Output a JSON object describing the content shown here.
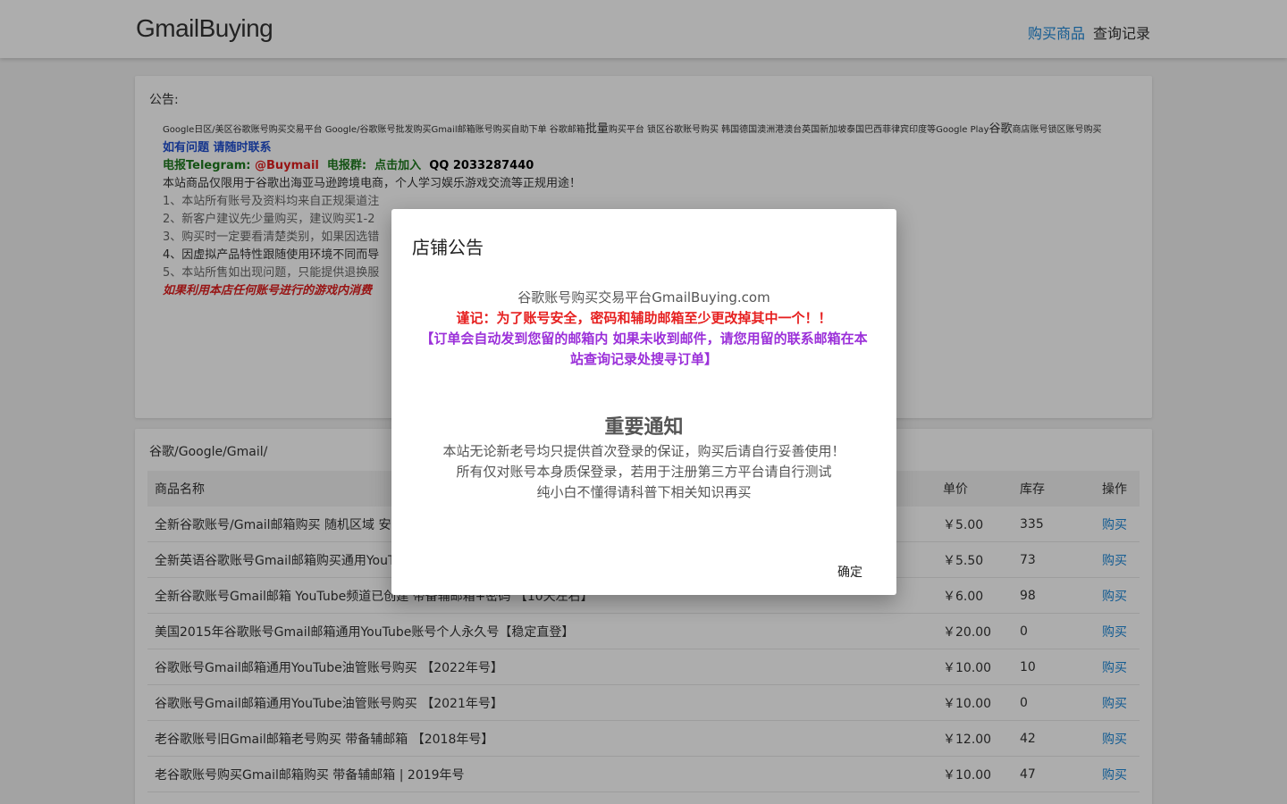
{
  "header": {
    "logo": "GmailBuying",
    "nav": [
      "购买商品",
      "查询记录"
    ]
  },
  "notice": {
    "title": "公告:",
    "line1_part1": "Google日区/美区谷歌账号购买交易平台 Google/谷歌账号批发购买Gmail邮箱账号购买自助下单 谷歌邮箱",
    "line1_big1": "批量",
    "line1_part2": "购买平台 锁区谷歌账号购买 韩国德国澳洲港澳台英国新加坡泰国巴西菲律宾印度等Google Play",
    "line1_big2": "谷歌",
    "line1_part3": "商店账号锁区账号购买",
    "contact_line": "如有问题 请随时联系",
    "telegram_label": "电报Telegram: ",
    "telegram_handle": "@Buymail",
    "group_label": "  电报群:  点击加入  ",
    "qq": "QQ 2033287440",
    "usage": "本站商品仅限用于谷歌出海亚马逊跨境电商，个人学习娱乐游戏交流等正规用途！",
    "item1": "1、本站所有账号及资料均来自正规渠道注",
    "item2": "2、新客户建议先少量购买，建议购买1-2",
    "item3": "3、购买时一定要看清楚类别，如果因选错",
    "item4": "4、因虚拟产品特性跟随使用环境不同而导",
    "item5": "5、本站所售如出现问题，只能提供退换服",
    "warning": "如果利用本店任何账号进行的游戏内消费"
  },
  "products": {
    "title": "谷歌/Google/Gmail/",
    "headers": {
      "name": "商品名称",
      "price": "单价",
      "stock": "库存",
      "op": "操作"
    },
    "buy_label": "购买",
    "rows": [
      {
        "name": "全新谷歌账号/Gmail邮箱购买 随机区域 安全",
        "price": "￥5.00",
        "stock": "335"
      },
      {
        "name": "全新英语谷歌账号Gmail邮箱购买通用YouTu",
        "price": "￥5.50",
        "stock": "73"
      },
      {
        "name": "全新谷歌账号Gmail邮箱 YouTube频道已创建 带备辅邮箱+密码 【10天左右】",
        "price": "￥6.00",
        "stock": "98"
      },
      {
        "name": "美国2015年谷歌账号Gmail邮箱通用YouTube账号个人永久号【稳定直登】",
        "price": "￥20.00",
        "stock": "0"
      },
      {
        "name": "谷歌账号Gmail邮箱通用YouTube油管账号购买 【2022年号】",
        "price": "￥10.00",
        "stock": "10"
      },
      {
        "name": "谷歌账号Gmail邮箱通用YouTube油管账号购买 【2021年号】",
        "price": "￥10.00",
        "stock": "0"
      },
      {
        "name": "老谷歌账号旧Gmail邮箱老号购买 带备辅邮箱 【2018年号】",
        "price": "￥12.00",
        "stock": "42"
      },
      {
        "name": "老谷歌账号购买Gmail邮箱购买 带备辅邮箱 | 2019年号",
        "price": "￥10.00",
        "stock": "47"
      }
    ]
  },
  "modal": {
    "title": "店铺公告",
    "site_line": "谷歌账号购买交易平台GmailBuying.com",
    "red_line": "谨记：为了账号安全，密码和辅助邮箱至少更改掉其中一个！！",
    "purple_line": "【订单会自动发到您留的邮箱内 如果未收到邮件，请您用留的联系邮箱在本站查询记录处搜寻订单】",
    "heading": "重要通知",
    "grey1": "本站无论新老号均只提供首次登录的保证，购买后请自行妥善使用！",
    "grey2": "所有仅对账号本身质保登录，若用于注册第三方平台请自行测试",
    "grey3": "纯小白不懂得请科普下相关知识再买",
    "ok_label": "确定"
  }
}
